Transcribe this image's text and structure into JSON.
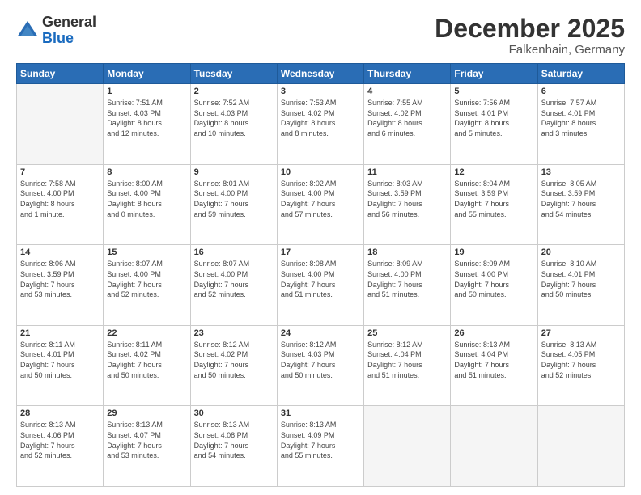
{
  "header": {
    "logo_general": "General",
    "logo_blue": "Blue",
    "month_title": "December 2025",
    "location": "Falkenhain, Germany"
  },
  "calendar": {
    "days_of_week": [
      "Sunday",
      "Monday",
      "Tuesday",
      "Wednesday",
      "Thursday",
      "Friday",
      "Saturday"
    ],
    "weeks": [
      [
        {
          "day": "",
          "info": ""
        },
        {
          "day": "1",
          "info": "Sunrise: 7:51 AM\nSunset: 4:03 PM\nDaylight: 8 hours\nand 12 minutes."
        },
        {
          "day": "2",
          "info": "Sunrise: 7:52 AM\nSunset: 4:03 PM\nDaylight: 8 hours\nand 10 minutes."
        },
        {
          "day": "3",
          "info": "Sunrise: 7:53 AM\nSunset: 4:02 PM\nDaylight: 8 hours\nand 8 minutes."
        },
        {
          "day": "4",
          "info": "Sunrise: 7:55 AM\nSunset: 4:02 PM\nDaylight: 8 hours\nand 6 minutes."
        },
        {
          "day": "5",
          "info": "Sunrise: 7:56 AM\nSunset: 4:01 PM\nDaylight: 8 hours\nand 5 minutes."
        },
        {
          "day": "6",
          "info": "Sunrise: 7:57 AM\nSunset: 4:01 PM\nDaylight: 8 hours\nand 3 minutes."
        }
      ],
      [
        {
          "day": "7",
          "info": "Sunrise: 7:58 AM\nSunset: 4:00 PM\nDaylight: 8 hours\nand 1 minute."
        },
        {
          "day": "8",
          "info": "Sunrise: 8:00 AM\nSunset: 4:00 PM\nDaylight: 8 hours\nand 0 minutes."
        },
        {
          "day": "9",
          "info": "Sunrise: 8:01 AM\nSunset: 4:00 PM\nDaylight: 7 hours\nand 59 minutes."
        },
        {
          "day": "10",
          "info": "Sunrise: 8:02 AM\nSunset: 4:00 PM\nDaylight: 7 hours\nand 57 minutes."
        },
        {
          "day": "11",
          "info": "Sunrise: 8:03 AM\nSunset: 3:59 PM\nDaylight: 7 hours\nand 56 minutes."
        },
        {
          "day": "12",
          "info": "Sunrise: 8:04 AM\nSunset: 3:59 PM\nDaylight: 7 hours\nand 55 minutes."
        },
        {
          "day": "13",
          "info": "Sunrise: 8:05 AM\nSunset: 3:59 PM\nDaylight: 7 hours\nand 54 minutes."
        }
      ],
      [
        {
          "day": "14",
          "info": "Sunrise: 8:06 AM\nSunset: 3:59 PM\nDaylight: 7 hours\nand 53 minutes."
        },
        {
          "day": "15",
          "info": "Sunrise: 8:07 AM\nSunset: 4:00 PM\nDaylight: 7 hours\nand 52 minutes."
        },
        {
          "day": "16",
          "info": "Sunrise: 8:07 AM\nSunset: 4:00 PM\nDaylight: 7 hours\nand 52 minutes."
        },
        {
          "day": "17",
          "info": "Sunrise: 8:08 AM\nSunset: 4:00 PM\nDaylight: 7 hours\nand 51 minutes."
        },
        {
          "day": "18",
          "info": "Sunrise: 8:09 AM\nSunset: 4:00 PM\nDaylight: 7 hours\nand 51 minutes."
        },
        {
          "day": "19",
          "info": "Sunrise: 8:09 AM\nSunset: 4:00 PM\nDaylight: 7 hours\nand 50 minutes."
        },
        {
          "day": "20",
          "info": "Sunrise: 8:10 AM\nSunset: 4:01 PM\nDaylight: 7 hours\nand 50 minutes."
        }
      ],
      [
        {
          "day": "21",
          "info": "Sunrise: 8:11 AM\nSunset: 4:01 PM\nDaylight: 7 hours\nand 50 minutes."
        },
        {
          "day": "22",
          "info": "Sunrise: 8:11 AM\nSunset: 4:02 PM\nDaylight: 7 hours\nand 50 minutes."
        },
        {
          "day": "23",
          "info": "Sunrise: 8:12 AM\nSunset: 4:02 PM\nDaylight: 7 hours\nand 50 minutes."
        },
        {
          "day": "24",
          "info": "Sunrise: 8:12 AM\nSunset: 4:03 PM\nDaylight: 7 hours\nand 50 minutes."
        },
        {
          "day": "25",
          "info": "Sunrise: 8:12 AM\nSunset: 4:04 PM\nDaylight: 7 hours\nand 51 minutes."
        },
        {
          "day": "26",
          "info": "Sunrise: 8:13 AM\nSunset: 4:04 PM\nDaylight: 7 hours\nand 51 minutes."
        },
        {
          "day": "27",
          "info": "Sunrise: 8:13 AM\nSunset: 4:05 PM\nDaylight: 7 hours\nand 52 minutes."
        }
      ],
      [
        {
          "day": "28",
          "info": "Sunrise: 8:13 AM\nSunset: 4:06 PM\nDaylight: 7 hours\nand 52 minutes."
        },
        {
          "day": "29",
          "info": "Sunrise: 8:13 AM\nSunset: 4:07 PM\nDaylight: 7 hours\nand 53 minutes."
        },
        {
          "day": "30",
          "info": "Sunrise: 8:13 AM\nSunset: 4:08 PM\nDaylight: 7 hours\nand 54 minutes."
        },
        {
          "day": "31",
          "info": "Sunrise: 8:13 AM\nSunset: 4:09 PM\nDaylight: 7 hours\nand 55 minutes."
        },
        {
          "day": "",
          "info": ""
        },
        {
          "day": "",
          "info": ""
        },
        {
          "day": "",
          "info": ""
        }
      ]
    ]
  }
}
